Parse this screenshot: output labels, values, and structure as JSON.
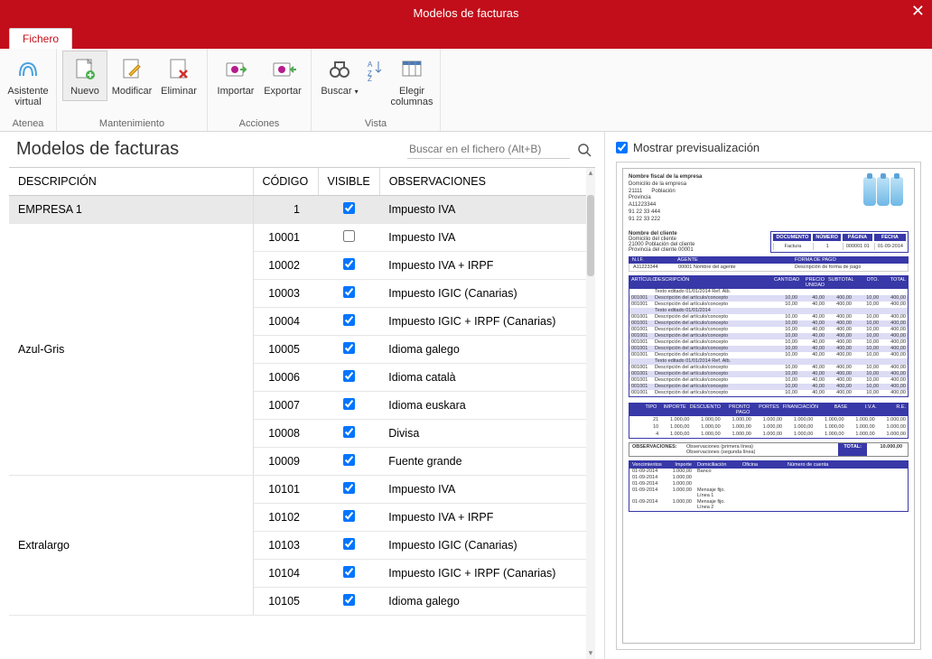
{
  "window": {
    "title": "Modelos de facturas"
  },
  "tab": {
    "label": "Fichero"
  },
  "ribbon": {
    "groups": [
      {
        "label": "Atenea",
        "buttons": [
          {
            "id": "asistente",
            "label": "Asistente\nvirtual"
          }
        ]
      },
      {
        "label": "Mantenimiento",
        "buttons": [
          {
            "id": "nuevo",
            "label": "Nuevo",
            "selected": true
          },
          {
            "id": "modificar",
            "label": "Modificar"
          },
          {
            "id": "eliminar",
            "label": "Eliminar"
          }
        ]
      },
      {
        "label": "Acciones",
        "buttons": [
          {
            "id": "importar",
            "label": "Importar"
          },
          {
            "id": "exportar",
            "label": "Exportar"
          }
        ]
      },
      {
        "label": "Vista",
        "buttons": [
          {
            "id": "buscar",
            "label": "Buscar",
            "dropdown": true
          },
          {
            "id": "sort",
            "label": ""
          },
          {
            "id": "columnas",
            "label": "Elegir\ncolumnas"
          }
        ]
      }
    ]
  },
  "left": {
    "heading": "Modelos de facturas",
    "search_placeholder": "Buscar en el fichero (Alt+B)",
    "columns": [
      "DESCRIPCIÓN",
      "CÓDIGO",
      "VISIBLE",
      "OBSERVACIONES"
    ],
    "groups": [
      {
        "desc": "EMPRESA 1",
        "rows": [
          {
            "code": "1",
            "visible": true,
            "obs": "Impuesto IVA",
            "selected": true
          }
        ]
      },
      {
        "desc": "Azul-Gris",
        "rows": [
          {
            "code": "10001",
            "visible": false,
            "obs": "Impuesto IVA"
          },
          {
            "code": "10002",
            "visible": true,
            "obs": "Impuesto IVA + IRPF"
          },
          {
            "code": "10003",
            "visible": true,
            "obs": "Impuesto IGIC (Canarias)"
          },
          {
            "code": "10004",
            "visible": true,
            "obs": "Impuesto IGIC + IRPF (Canarias)"
          },
          {
            "code": "10005",
            "visible": true,
            "obs": "Idioma galego"
          },
          {
            "code": "10006",
            "visible": true,
            "obs": "Idioma català"
          },
          {
            "code": "10007",
            "visible": true,
            "obs": "Idioma euskara"
          },
          {
            "code": "10008",
            "visible": true,
            "obs": "Divisa"
          },
          {
            "code": "10009",
            "visible": true,
            "obs": "Fuente grande"
          }
        ]
      },
      {
        "desc": "Extralargo",
        "rows": [
          {
            "code": "10101",
            "visible": true,
            "obs": "Impuesto IVA"
          },
          {
            "code": "10102",
            "visible": true,
            "obs": "Impuesto IVA + IRPF"
          },
          {
            "code": "10103",
            "visible": true,
            "obs": "Impuesto IGIC (Canarias)"
          },
          {
            "code": "10104",
            "visible": true,
            "obs": "Impuesto IGIC + IRPF (Canarias)"
          },
          {
            "code": "10105",
            "visible": true,
            "obs": "Idioma galego"
          }
        ]
      }
    ]
  },
  "right": {
    "checkbox_label": "Mostrar previsualización",
    "checked": true
  },
  "preview": {
    "company": {
      "l1": "Nombre fiscal de la empresa",
      "l2": "Domicilio de la empresa",
      "l3": "21111",
      "l3b": "Población",
      "l4": "Provincia",
      "l5": "A11223344",
      "l6": "91 22 33 444",
      "l7": "91 22 33 222"
    },
    "client": {
      "l1": "Nombre del cliente",
      "l2": "Domicilio del cliente",
      "l3": "21000   Población del cliente",
      "l4": "Provincia del cliente    00001"
    },
    "docbox": {
      "headers": [
        "DOCUMENTO",
        "NÚMERO",
        "PÁGINA",
        "FECHA"
      ],
      "row": [
        "Factura",
        "1",
        "000001  01",
        "01-09-2014"
      ]
    },
    "nif_agent": {
      "headers": [
        "N.I.F.",
        "AGENTE",
        "FORMA DE PAGO"
      ],
      "row": [
        "A11223344",
        "00001   Nombre del agente",
        "Descripción de forma de pago"
      ]
    },
    "items": {
      "headers": [
        "ARTÍCULO",
        "DESCRIPCIÓN",
        "CANTIDAD",
        "PRECIO UNIDAD",
        "SUBTOTAL",
        "DTO.",
        "TOTAL"
      ],
      "rows": [
        [
          "",
          "Texto editado      01/01/2014   Ref. Alb.",
          "",
          "",
          "",
          "",
          ""
        ],
        [
          "001001",
          "Descripción del artículo/concepto",
          "10,00",
          "40,00",
          "400,00",
          "10,00",
          "400,00"
        ],
        [
          "001001",
          "Descripción del artículo/concepto",
          "10,00",
          "40,00",
          "400,00",
          "10,00",
          "400,00"
        ],
        [
          "",
          "Texto editado      01/01/2014",
          "",
          "",
          "",
          "",
          ""
        ],
        [
          "001001",
          "Descripción del artículo/concepto",
          "10,00",
          "40,00",
          "400,00",
          "10,00",
          "400,00"
        ],
        [
          "001001",
          "Descripción del artículo/concepto",
          "10,00",
          "40,00",
          "400,00",
          "10,00",
          "400,00"
        ],
        [
          "001001",
          "Descripción del artículo/concepto",
          "10,00",
          "40,00",
          "400,00",
          "10,00",
          "400,00"
        ],
        [
          "001001",
          "Descripción del artículo/concepto",
          "10,00",
          "40,00",
          "400,00",
          "10,00",
          "400,00"
        ],
        [
          "001001",
          "Descripción del artículo/concepto",
          "10,00",
          "40,00",
          "400,00",
          "10,00",
          "400,00"
        ],
        [
          "001001",
          "Descripción del artículo/concepto",
          "10,00",
          "40,00",
          "400,00",
          "10,00",
          "400,00"
        ],
        [
          "001001",
          "Descripción del artículo/concepto",
          "10,00",
          "40,00",
          "400,00",
          "10,00",
          "400,00"
        ],
        [
          "",
          "Texto editado      01/01/2014   Ref. Alb.",
          "",
          "",
          "",
          "",
          ""
        ],
        [
          "001001",
          "Descripción del artículo/concepto",
          "10,00",
          "40,00",
          "400,00",
          "10,00",
          "400,00"
        ],
        [
          "001001",
          "Descripción del artículo/concepto",
          "10,00",
          "40,00",
          "400,00",
          "10,00",
          "400,00"
        ],
        [
          "001001",
          "Descripción del artículo/concepto",
          "10,00",
          "40,00",
          "400,00",
          "10,00",
          "400,00"
        ],
        [
          "001001",
          "Descripción del artículo/concepto",
          "10,00",
          "40,00",
          "400,00",
          "10,00",
          "400,00"
        ],
        [
          "001001",
          "Descripción del artículo/concepto",
          "10,00",
          "40,00",
          "400,00",
          "10,00",
          "400,00"
        ]
      ]
    },
    "totals": {
      "headers": [
        "TIPO",
        "IMPORTE",
        "DESCUENTO",
        "PRONTO PAGO",
        "PORTES",
        "FINANCIACIÓN",
        "BASE",
        "I.V.A.",
        "R.E."
      ],
      "rows": [
        [
          "21",
          "1.000,00",
          "1.000,00",
          "1.000,00",
          "1.000,00",
          "1.000,00",
          "1.000,00",
          "1.000,00",
          "1.000,00"
        ],
        [
          "10",
          "1.000,00",
          "1.000,00",
          "1.000,00",
          "1.000,00",
          "1.000,00",
          "1.000,00",
          "1.000,00",
          "1.000,00"
        ],
        [
          "4",
          "1.000,00",
          "1.000,00",
          "1.000,00",
          "1.000,00",
          "1.000,00",
          "1.000,00",
          "1.000,00",
          "1.000,00"
        ]
      ]
    },
    "obs": {
      "label": "OBSERVACIONES:",
      "l1": "Observaciones (primera línea)",
      "l2": "Observaciones (segunda línea)",
      "total_label": "TOTAL:",
      "total": "10.000,00"
    },
    "venc": {
      "headers": [
        "Vencimientos",
        "Importe",
        "Domiciliación",
        "Oficina",
        "Número de cuenta"
      ],
      "rows": [
        [
          "01-09-2014",
          "1.000,00",
          "Banco",
          "",
          ""
        ],
        [
          "01-09-2014",
          "1.000,00",
          "",
          "",
          ""
        ],
        [
          "01-09-2014",
          "1.000,00",
          "",
          "",
          ""
        ],
        [
          "01-09-2014",
          "1.000,00",
          "Mensaje fijo. Línea 1",
          "",
          ""
        ],
        [
          "01-09-2014",
          "1.000,00",
          "Mensaje fijo. Línea 2",
          "",
          ""
        ]
      ]
    }
  }
}
